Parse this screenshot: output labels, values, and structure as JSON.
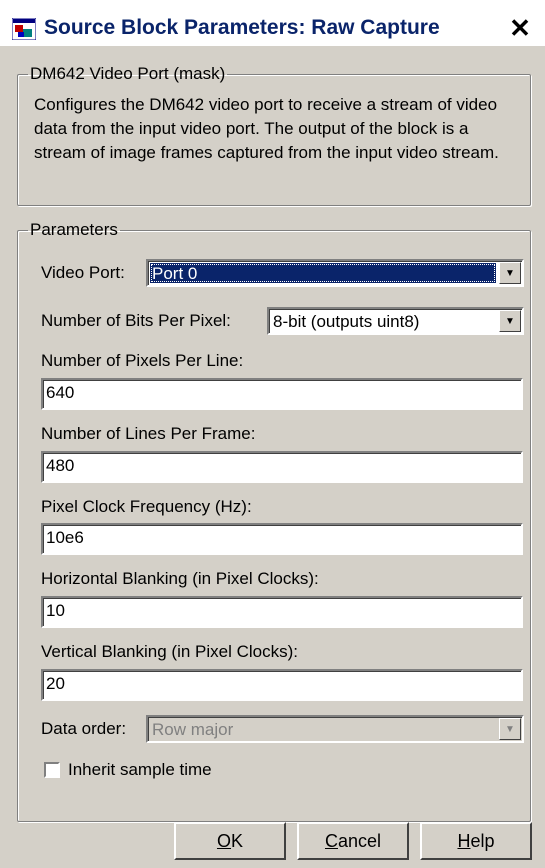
{
  "window": {
    "title": "Source Block Parameters: Raw Capture",
    "close_symbol": "✕"
  },
  "mask": {
    "legend": "DM642 Video Port (mask)",
    "description": "Configures the DM642 video port to receive a stream of video data from the input video port. The output of the block is a stream of image frames captured from the input video stream."
  },
  "parameters": {
    "legend": "Parameters",
    "video_port": {
      "label": "Video Port:",
      "value": "Port 0"
    },
    "bits_per_pixel": {
      "label": "Number of Bits Per Pixel:",
      "value": "8-bit  (outputs uint8)"
    },
    "pixels_per_line": {
      "label": "Number of Pixels Per Line:",
      "value": "640"
    },
    "lines_per_frame": {
      "label": "Number of Lines Per Frame:",
      "value": "480"
    },
    "pixel_clock": {
      "label": "Pixel Clock Frequency (Hz):",
      "value": "10e6"
    },
    "horizontal_blanking": {
      "label": "Horizontal Blanking (in Pixel Clocks):",
      "value": "10"
    },
    "vertical_blanking": {
      "label": "Vertical Blanking (in Pixel Clocks):",
      "value": "20"
    },
    "data_order": {
      "label": "Data order:",
      "value": "Row major",
      "disabled": true
    },
    "inherit_sample_time": {
      "label": "Inherit sample time",
      "checked": false
    }
  },
  "buttons": {
    "ok": {
      "prefix": "",
      "accel": "O",
      "suffix": "K"
    },
    "cancel": {
      "prefix": "",
      "accel": "C",
      "suffix": "ancel"
    },
    "help": {
      "prefix": "",
      "accel": "H",
      "suffix": "elp"
    }
  },
  "icons": {
    "app": "simulink-block-icon",
    "dropdown": "chevron-down-icon"
  }
}
